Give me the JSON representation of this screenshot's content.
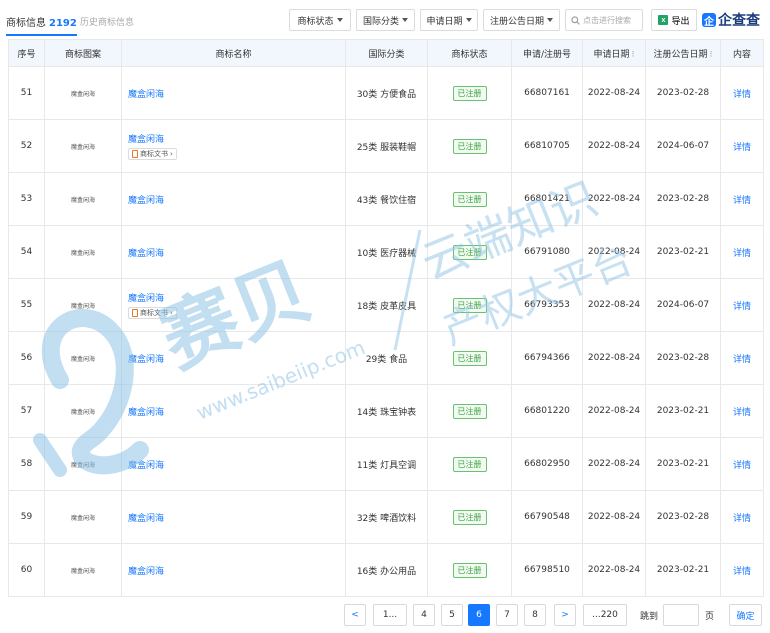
{
  "tabs": {
    "active_label": "商标信息",
    "active_count": "2192",
    "inactive_label": "历史商标信息"
  },
  "filters": {
    "status": "商标状态",
    "category": "国际分类",
    "apply_date": "申请日期",
    "notice_date": "注册公告日期"
  },
  "search": {
    "placeholder": "点击进行搜索"
  },
  "export_label": "导出",
  "brand": {
    "mark": "企",
    "name": "企查查"
  },
  "table": {
    "headers": [
      "序号",
      "商标图案",
      "商标名称",
      "国际分类",
      "商标状态",
      "申请/注册号",
      "申请日期",
      "注册公告日期",
      "内容"
    ],
    "rows": [
      {
        "no": "51",
        "image": "魔盒闲海",
        "name": "魔盒闲海",
        "doc": "",
        "category": "30类 方便食品",
        "status": "已注册",
        "reg_no": "66807161",
        "apply": "2022-08-24",
        "notice": "2023-02-28",
        "detail": "详情"
      },
      {
        "no": "52",
        "image": "魔盒闲海",
        "name": "魔盒闲海",
        "doc": "商标文书",
        "category": "25类 服装鞋帽",
        "status": "已注册",
        "reg_no": "66810705",
        "apply": "2022-08-24",
        "notice": "2024-06-07",
        "detail": "详情"
      },
      {
        "no": "53",
        "image": "魔盒闲海",
        "name": "魔盒闲海",
        "doc": "",
        "category": "43类 餐饮住宿",
        "status": "已注册",
        "reg_no": "66801421",
        "apply": "2022-08-24",
        "notice": "2023-02-28",
        "detail": "详情"
      },
      {
        "no": "54",
        "image": "魔盒闲海",
        "name": "魔盒闲海",
        "doc": "",
        "category": "10类 医疗器械",
        "status": "已注册",
        "reg_no": "66791080",
        "apply": "2022-08-24",
        "notice": "2023-02-21",
        "detail": "详情"
      },
      {
        "no": "55",
        "image": "魔盒闲海",
        "name": "魔盒闲海",
        "doc": "商标文书",
        "category": "18类 皮革皮具",
        "status": "已注册",
        "reg_no": "66793353",
        "apply": "2022-08-24",
        "notice": "2024-06-07",
        "detail": "详情"
      },
      {
        "no": "56",
        "image": "魔盒闲海",
        "name": "魔盒闲海",
        "doc": "",
        "category": "29类 食品",
        "status": "已注册",
        "reg_no": "66794366",
        "apply": "2022-08-24",
        "notice": "2023-02-28",
        "detail": "详情"
      },
      {
        "no": "57",
        "image": "魔盒闲海",
        "name": "魔盒闲海",
        "doc": "",
        "category": "14类 珠宝钟表",
        "status": "已注册",
        "reg_no": "66801220",
        "apply": "2022-08-24",
        "notice": "2023-02-21",
        "detail": "详情"
      },
      {
        "no": "58",
        "image": "魔盒闲海",
        "name": "魔盒闲海",
        "doc": "",
        "category": "11类 灯具空调",
        "status": "已注册",
        "reg_no": "66802950",
        "apply": "2022-08-24",
        "notice": "2023-02-21",
        "detail": "详情"
      },
      {
        "no": "59",
        "image": "魔盒闲海",
        "name": "魔盒闲海",
        "doc": "",
        "category": "32类 啤酒饮料",
        "status": "已注册",
        "reg_no": "66790548",
        "apply": "2022-08-24",
        "notice": "2023-02-28",
        "detail": "详情"
      },
      {
        "no": "60",
        "image": "魔盒闲海",
        "name": "魔盒闲海",
        "doc": "",
        "category": "16类 办公用品",
        "status": "已注册",
        "reg_no": "66798510",
        "apply": "2022-08-24",
        "notice": "2023-02-21",
        "detail": "详情"
      }
    ]
  },
  "pagination": {
    "prev": "<",
    "first": "1...",
    "pages": [
      "4",
      "5",
      "6",
      "7",
      "8"
    ],
    "current": "6",
    "next": ">",
    "last": "...220",
    "jump_label": "跳到",
    "page_unit": "页",
    "confirm": "确定"
  },
  "watermark": {
    "brand": "赛贝",
    "url": "www.saibeiip.com",
    "slogan_1": "云端知识",
    "slogan_2": "产权大平台"
  },
  "colors": {
    "accent": "#1677ff",
    "status_green": "#3aa13f",
    "header_bg": "#f2f7fd",
    "watermark": "#8fc3e6"
  }
}
